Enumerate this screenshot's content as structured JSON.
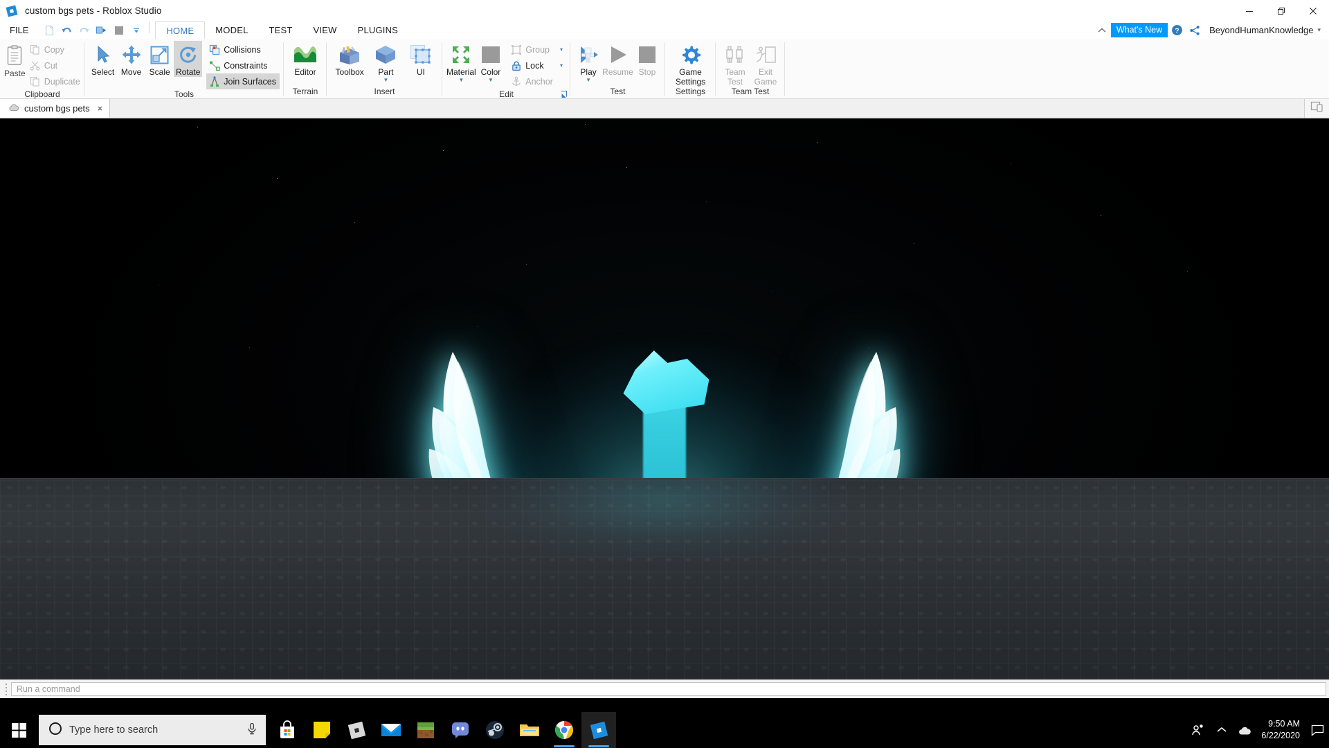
{
  "window": {
    "title": "custom bgs pets - Roblox Studio",
    "logo_icon": "roblox-studio-logo-icon",
    "minimize_label": "Minimize",
    "maximize_label": "Restore",
    "close_label": "Close"
  },
  "menubar": {
    "file_label": "FILE",
    "quick_access": [
      {
        "name": "new-file-icon",
        "label": "New"
      },
      {
        "name": "undo-icon",
        "label": "Undo"
      },
      {
        "name": "redo-icon",
        "label": "Redo"
      },
      {
        "name": "publish-icon",
        "label": "Publish"
      },
      {
        "name": "stop-square-icon",
        "label": "Stop"
      },
      {
        "name": "customize-caret-icon",
        "label": "Customize Quick Access Toolbar"
      }
    ],
    "tabs": [
      {
        "label": "HOME",
        "active": true
      },
      {
        "label": "MODEL",
        "active": false
      },
      {
        "label": "TEST",
        "active": false
      },
      {
        "label": "VIEW",
        "active": false
      },
      {
        "label": "PLUGINS",
        "active": false
      }
    ],
    "right": {
      "home_icon": "home-chevron-icon",
      "whats_new": "What's New",
      "help_icon": "help-question-icon",
      "share_icon": "share-icon",
      "username": "BeyondHumanKnowledge",
      "user_caret": "▾"
    }
  },
  "ribbon": {
    "groups": [
      {
        "label": "Clipboard",
        "paste": {
          "label": "Paste",
          "icon": "paste-clipboard-icon",
          "enabled": true
        },
        "items": [
          {
            "label": "Copy",
            "icon": "copy-icon",
            "enabled": false
          },
          {
            "label": "Cut",
            "icon": "cut-scissors-icon",
            "enabled": false
          },
          {
            "label": "Duplicate",
            "icon": "duplicate-icon",
            "enabled": false
          }
        ]
      },
      {
        "label": "Tools",
        "buttons": [
          {
            "label": "Select",
            "icon": "cursor-arrow-icon",
            "selected": false
          },
          {
            "label": "Move",
            "icon": "move-arrows-icon",
            "selected": false
          },
          {
            "label": "Scale",
            "icon": "scale-icon",
            "selected": false
          },
          {
            "label": "Rotate",
            "icon": "rotate-icon",
            "selected": true
          }
        ],
        "toggles": [
          {
            "label": "Collisions",
            "icon": "collisions-icon",
            "selected": false
          },
          {
            "label": "Constraints",
            "icon": "constraints-icon",
            "selected": false
          },
          {
            "label": "Join Surfaces",
            "icon": "join-surfaces-icon",
            "selected": true
          }
        ]
      },
      {
        "label": "Terrain",
        "buttons": [
          {
            "label": "Editor",
            "icon": "terrain-editor-icon"
          }
        ]
      },
      {
        "label": "Insert",
        "buttons": [
          {
            "label": "Toolbox",
            "icon": "toolbox-icon",
            "caret": false
          },
          {
            "label": "Part",
            "icon": "part-cube-icon",
            "caret": true
          },
          {
            "label": "UI",
            "icon": "ui-frame-icon",
            "caret": false
          }
        ]
      },
      {
        "label": "Edit",
        "buttons": [
          {
            "label": "Material",
            "icon": "material-arrows-icon",
            "caret": true
          },
          {
            "label": "Color",
            "icon": "color-swatch-icon",
            "caret": true
          }
        ],
        "toggles": [
          {
            "label": "Group",
            "icon": "group-icon",
            "enabled": false,
            "caret": true
          },
          {
            "label": "Lock",
            "icon": "lock-icon",
            "enabled": true,
            "caret": true
          },
          {
            "label": "Anchor",
            "icon": "anchor-icon",
            "enabled": false,
            "caret": false
          }
        ],
        "dialog_launcher": "edit-dialog-launcher-icon"
      },
      {
        "label": "Test",
        "buttons": [
          {
            "label": "Play",
            "icon": "play-avatar-icon",
            "enabled": true,
            "caret": true
          },
          {
            "label": "Resume",
            "icon": "resume-triangle-icon",
            "enabled": false,
            "caret": false
          },
          {
            "label": "Stop",
            "icon": "stop-square-icon",
            "enabled": false,
            "caret": false
          }
        ]
      },
      {
        "label": "Settings",
        "buttons": [
          {
            "label": "Game\nSettings",
            "line1": "Game",
            "line2": "Settings",
            "icon": "gear-icon",
            "enabled": true
          }
        ]
      },
      {
        "label": "Team Test",
        "buttons": [
          {
            "line1": "Team",
            "line2": "Test",
            "icon": "team-test-icon",
            "enabled": false
          },
          {
            "line1": "Exit",
            "line2": "Game",
            "icon": "exit-game-icon",
            "enabled": false
          }
        ]
      }
    ]
  },
  "doc_tabs": {
    "tabs": [
      {
        "label": "custom bgs pets",
        "icon": "cloud-icon",
        "close": "×",
        "active": true
      }
    ],
    "right_button_icon": "device-emulator-icon"
  },
  "viewport": {
    "name": "3d-viewport",
    "scene_description": "Glowing cyan neon winged star pet on dark studded baseplate",
    "background_color": "#000000",
    "ground_color": "#2e3338",
    "glow_color": "#4defff",
    "accent_color": "#ffffff"
  },
  "command_bar": {
    "placeholder": "Run a command",
    "value": "",
    "handle_icon": "drag-handle-icon"
  },
  "taskbar": {
    "start_icon": "windows-start-icon",
    "search": {
      "icon": "cortana-circle-icon",
      "placeholder": "Type here to search",
      "mic_icon": "microphone-icon"
    },
    "apps": [
      {
        "name": "microsoft-store-icon",
        "label": "Microsoft Store",
        "running": false,
        "active": false
      },
      {
        "name": "sticky-notes-icon",
        "label": "Sticky Notes",
        "running": false,
        "active": false
      },
      {
        "name": "roblox-player-icon",
        "label": "Roblox",
        "running": false,
        "active": false
      },
      {
        "name": "mail-icon",
        "label": "Mail",
        "running": false,
        "active": false
      },
      {
        "name": "minecraft-icon",
        "label": "Minecraft",
        "running": false,
        "active": false
      },
      {
        "name": "discord-icon",
        "label": "Discord",
        "running": false,
        "active": false
      },
      {
        "name": "steam-icon",
        "label": "Steam",
        "running": false,
        "active": false
      },
      {
        "name": "file-explorer-icon",
        "label": "File Explorer",
        "running": false,
        "active": false
      },
      {
        "name": "google-chrome-icon",
        "label": "Google Chrome",
        "running": true,
        "active": false
      },
      {
        "name": "roblox-studio-icon",
        "label": "Roblox Studio",
        "running": true,
        "active": true
      }
    ],
    "tray": [
      {
        "name": "people-icon",
        "label": "People"
      },
      {
        "name": "show-hidden-icons-icon",
        "label": "Show hidden icons"
      },
      {
        "name": "onedrive-cloud-icon",
        "label": "OneDrive"
      }
    ],
    "clock": {
      "time": "9:50 AM",
      "date": "6/22/2020"
    },
    "notifications_icon": "action-center-icon"
  }
}
